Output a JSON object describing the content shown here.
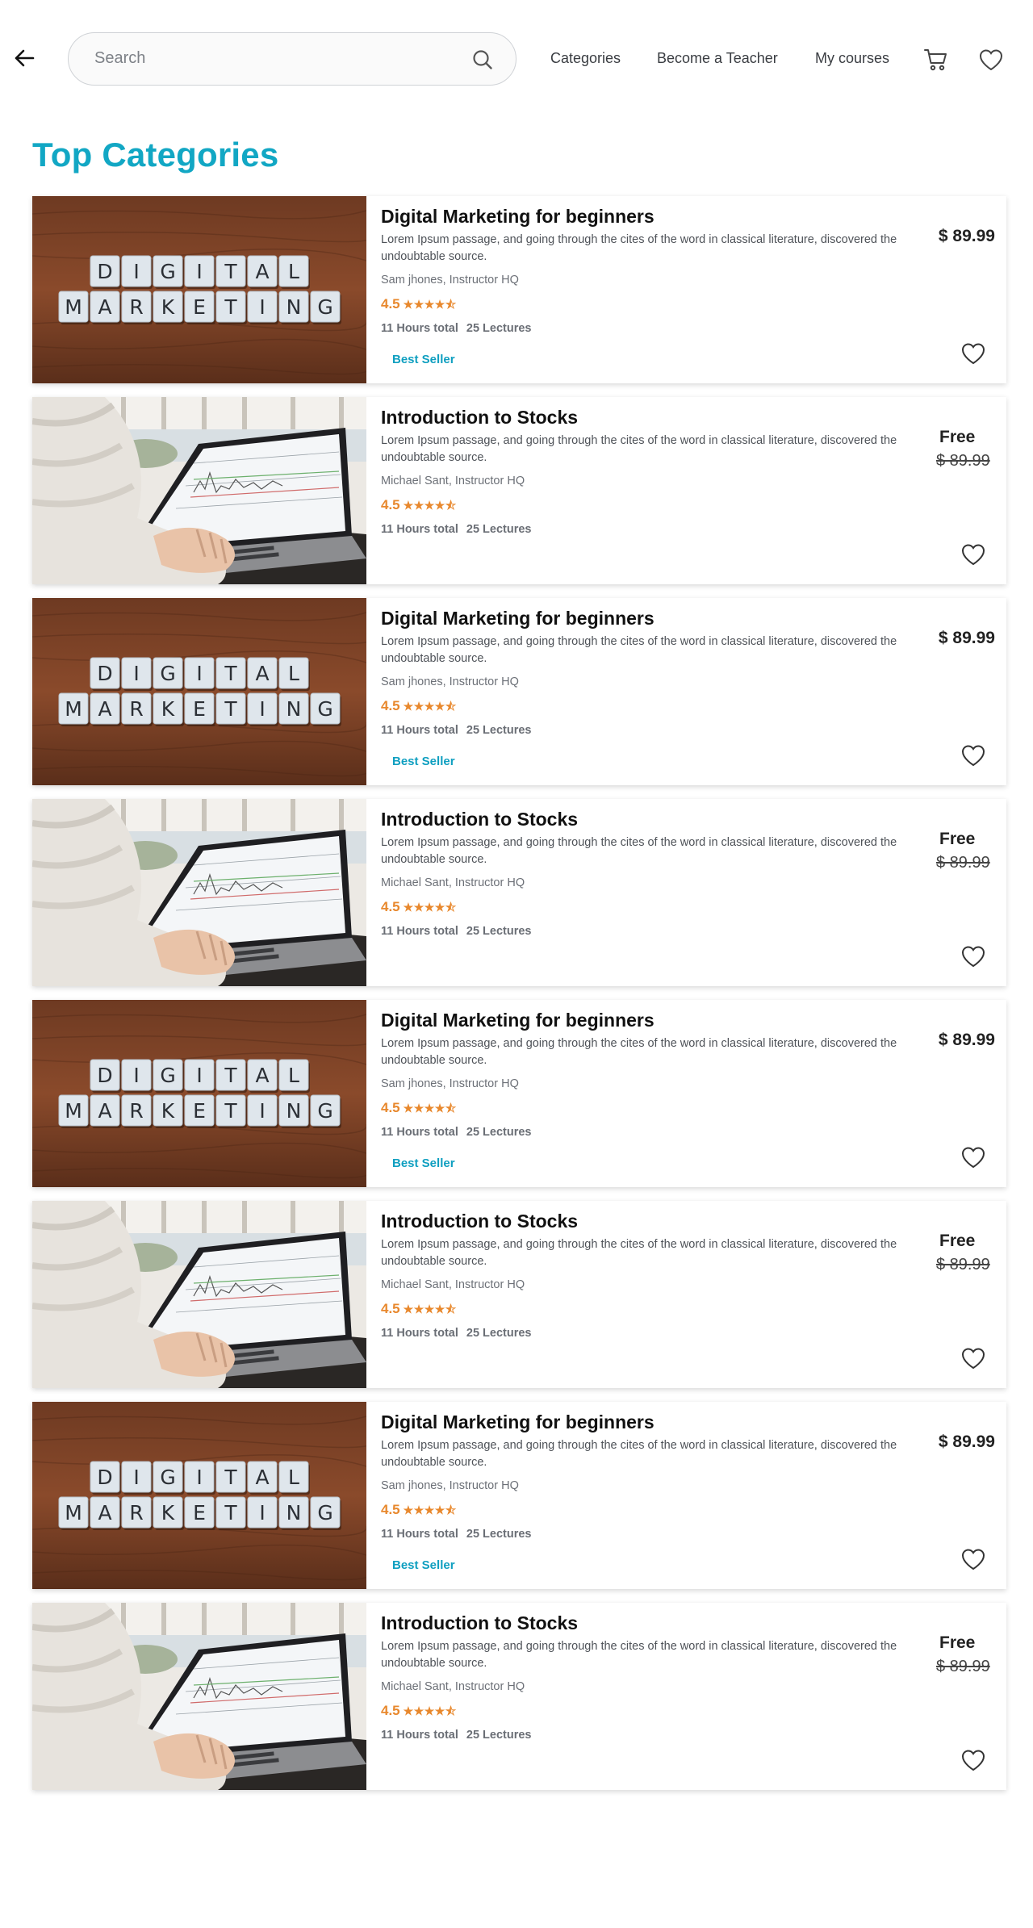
{
  "header": {
    "search_placeholder": "Search",
    "nav": [
      "Categories",
      "Become a Teacher",
      "My courses"
    ],
    "icons": {
      "back": "arrow-left-icon",
      "search": "search-icon",
      "cart": "cart-icon",
      "wishlist": "heart-icon"
    }
  },
  "main": {
    "title": "Top Categories"
  },
  "theme": {
    "accent": "#12a7c4",
    "rating": "#e8882d"
  },
  "courses": [
    {
      "type": "marketing",
      "title": "Digital Marketing for beginners",
      "description": "Lorem Ipsum passage, and going through the cites of the word in classical literature, discovered the undoubtable source.",
      "author": "Sam jhones, Instructor HQ",
      "rating": "4.5",
      "stars": "★★★★⯪",
      "hours": "11 Hours total",
      "lectures": "25 Lectures",
      "badge": "Best Seller",
      "price": "$ 89.99"
    },
    {
      "type": "stocks",
      "title": "Introduction to Stocks",
      "description": "Lorem Ipsum passage, and going through the cites of the word in classical literature, discovered the undoubtable source.",
      "author": "Michael Sant, Instructor HQ",
      "rating": "4.5",
      "stars": "★★★★⯪",
      "hours": "11 Hours total",
      "lectures": "25 Lectures",
      "price_label": "Free",
      "old_price": "$ 89.99"
    },
    {
      "type": "marketing",
      "title": "Digital Marketing for beginners",
      "description": "Lorem Ipsum passage, and going through the cites of the word in classical literature, discovered the undoubtable source.",
      "author": "Sam jhones, Instructor HQ",
      "rating": "4.5",
      "stars": "★★★★⯪",
      "hours": "11 Hours total",
      "lectures": "25 Lectures",
      "badge": "Best Seller",
      "price": "$ 89.99"
    },
    {
      "type": "stocks",
      "title": "Introduction to Stocks",
      "description": "Lorem Ipsum passage, and going through the cites of the word in classical literature, discovered the undoubtable source.",
      "author": "Michael Sant, Instructor HQ",
      "rating": "4.5",
      "stars": "★★★★⯪",
      "hours": "11 Hours total",
      "lectures": "25 Lectures",
      "price_label": "Free",
      "old_price": "$ 89.99"
    },
    {
      "type": "marketing",
      "title": "Digital Marketing for beginners",
      "description": "Lorem Ipsum passage, and going through the cites of the word in classical literature, discovered the undoubtable source.",
      "author": "Sam jhones, Instructor HQ",
      "rating": "4.5",
      "stars": "★★★★⯪",
      "hours": "11 Hours total",
      "lectures": "25 Lectures",
      "badge": "Best Seller",
      "price": "$ 89.99"
    },
    {
      "type": "stocks",
      "title": "Introduction to Stocks",
      "description": "Lorem Ipsum passage, and going through the cites of the word in classical literature, discovered the undoubtable source.",
      "author": "Michael Sant, Instructor HQ",
      "rating": "4.5",
      "stars": "★★★★⯪",
      "hours": "11 Hours total",
      "lectures": "25 Lectures",
      "price_label": "Free",
      "old_price": "$ 89.99"
    },
    {
      "type": "marketing",
      "title": "Digital Marketing for beginners",
      "description": "Lorem Ipsum passage, and going through the cites of the word in classical literature, discovered the undoubtable source.",
      "author": "Sam jhones, Instructor HQ",
      "rating": "4.5",
      "stars": "★★★★⯪",
      "hours": "11 Hours total",
      "lectures": "25 Lectures",
      "badge": "Best Seller",
      "price": "$ 89.99"
    },
    {
      "type": "stocks",
      "title": "Introduction to Stocks",
      "description": "Lorem Ipsum passage, and going through the cites of the word in classical literature, discovered the undoubtable source.",
      "author": "Michael Sant, Instructor HQ",
      "rating": "4.5",
      "stars": "★★★★⯪",
      "hours": "11 Hours total",
      "lectures": "25 Lectures",
      "price_label": "Free",
      "old_price": "$ 89.99"
    }
  ],
  "thumbnail_text": {
    "marketing": [
      "DIGITAL",
      "MARKETING"
    ]
  }
}
